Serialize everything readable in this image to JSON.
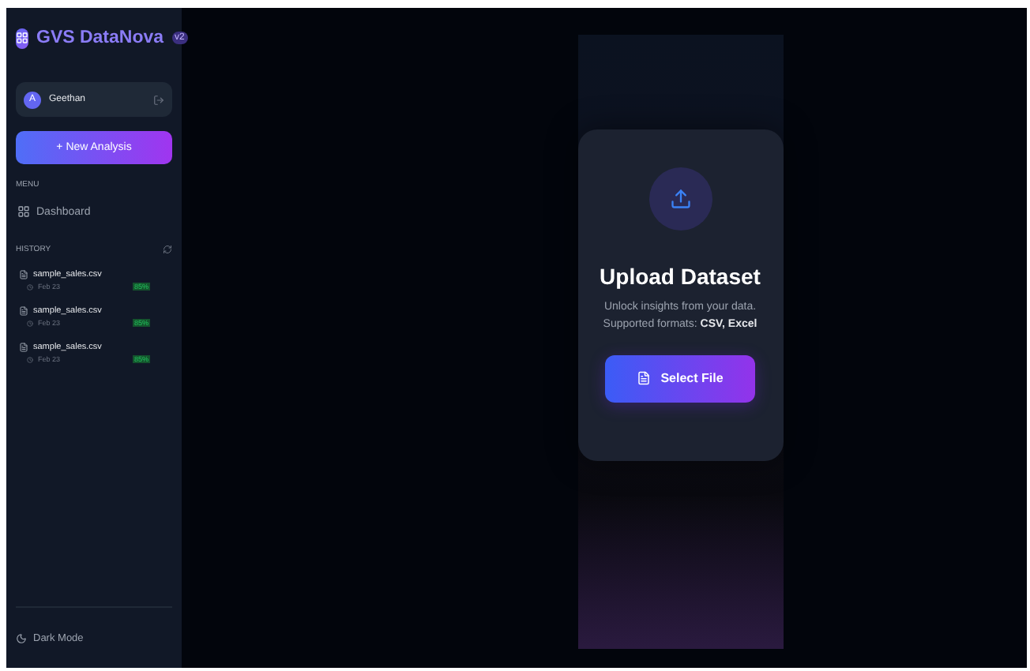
{
  "sidebar": {
    "brand": "GVS DataNova",
    "badge": "v2",
    "user": {
      "initial": "A",
      "name": "Geethan"
    },
    "new_button": "+ New Analysis",
    "menu_label": "MENU",
    "menu_items": [
      {
        "label": "Dashboard",
        "selected": false
      }
    ],
    "history_label": "HISTORY",
    "history": [
      {
        "name": "sample_sales.csv",
        "date": "Feb 23",
        "score": "85%"
      },
      {
        "name": "sample_sales.csv",
        "date": "Feb 23",
        "score": "85%"
      },
      {
        "name": "sample_sales.csv",
        "date": "Feb 23",
        "score": "85%"
      }
    ],
    "footer": "Dark Mode"
  },
  "upload": {
    "title": "Upload Dataset",
    "line1": "Unlock insights from your data.",
    "line2": "Supported formats: **CSV, Excel**",
    "button": "Select File"
  }
}
